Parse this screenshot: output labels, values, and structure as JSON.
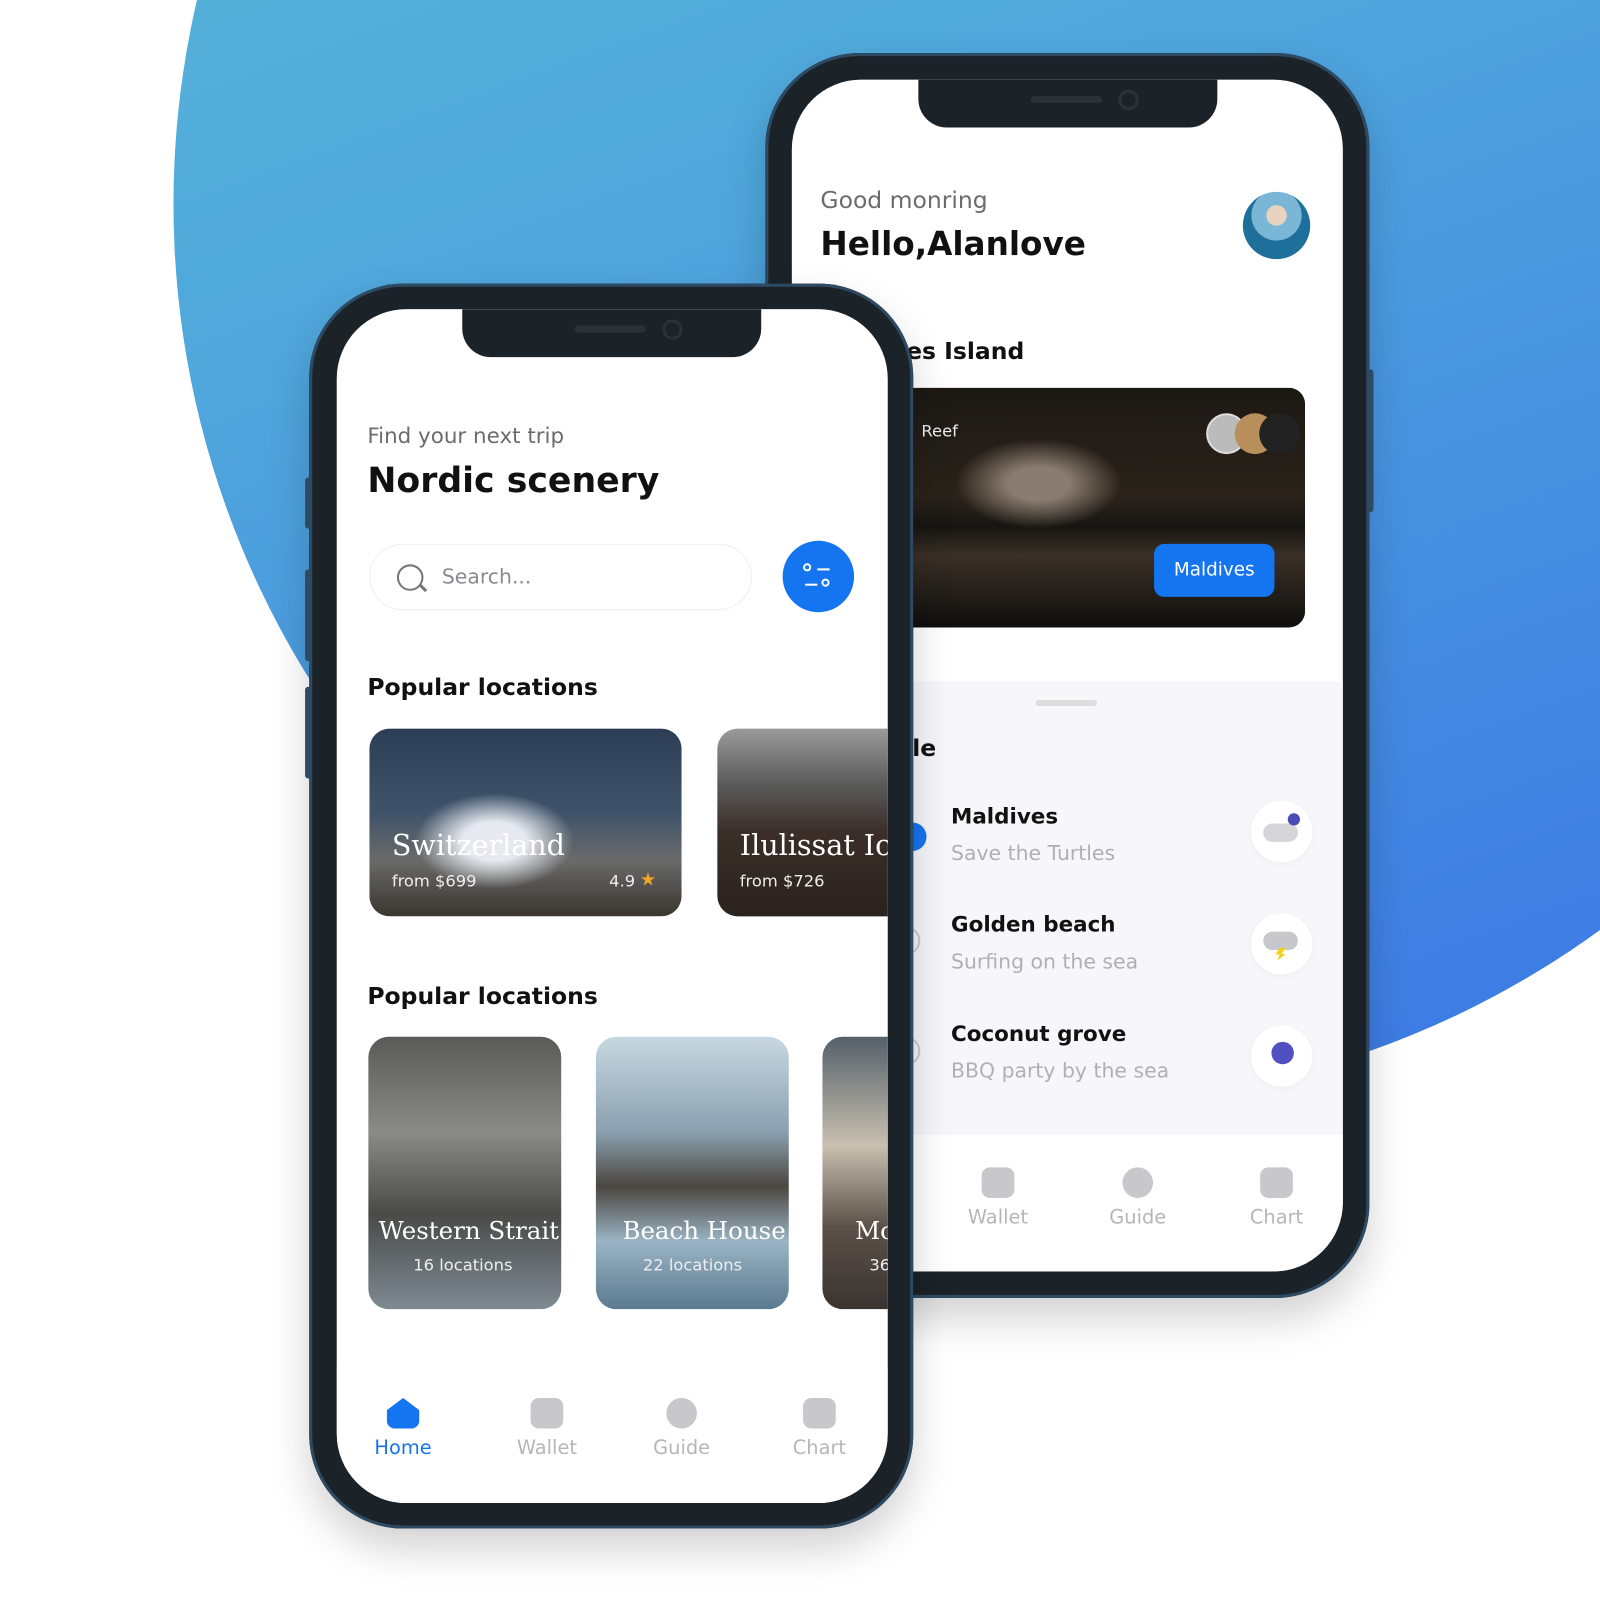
{
  "back_phone": {
    "greeting": "Good monring",
    "user_name": "Hello,Alanlove",
    "section_title_partial": "es Island",
    "featured_card": {
      "label_partial": "Reef",
      "button_label": "Maldives"
    },
    "schedule_title_partial": "le",
    "schedule": [
      {
        "title": "Maldives",
        "subtitle": "Save the Turtles",
        "weather_icon": "cloud-moon-wind-icon",
        "selected": true
      },
      {
        "title": "Golden beach",
        "subtitle": "Surfing on the sea",
        "weather_icon": "cloud-lightning-icon",
        "selected": false
      },
      {
        "title": "Coconut grove",
        "subtitle": "BBQ party by the sea",
        "weather_icon": "moon-wind-icon",
        "selected": false
      }
    ],
    "nav": [
      {
        "label": "Wallet",
        "icon": "wallet-icon"
      },
      {
        "label": "Guide",
        "icon": "compass-icon"
      },
      {
        "label": "Chart",
        "icon": "chart-icon"
      }
    ]
  },
  "front_phone": {
    "subtitle": "Find your next trip",
    "title": "Nordic scenery",
    "search": {
      "placeholder": "Search..."
    },
    "section1_title": "Popular locations",
    "popular": [
      {
        "name": "Switzerland",
        "price": "from $699",
        "rating": "4.9"
      },
      {
        "name": "Ilulissat Ic",
        "price": "from $726"
      }
    ],
    "section2_title": "Popular locations",
    "locations": [
      {
        "name": "Western Strait",
        "count": "16 locations"
      },
      {
        "name": "Beach House",
        "count": "22 locations"
      },
      {
        "name": "Mo",
        "count": "36"
      }
    ],
    "nav": [
      {
        "label": "Home",
        "icon": "home-icon",
        "active": true
      },
      {
        "label": "Wallet",
        "icon": "wallet-icon"
      },
      {
        "label": "Guide",
        "icon": "compass-icon"
      },
      {
        "label": "Chart",
        "icon": "chart-icon"
      }
    ]
  },
  "colors": {
    "accent": "#1574f0",
    "background_gradient": [
      "#5cc2d2",
      "#3a72e6"
    ]
  }
}
